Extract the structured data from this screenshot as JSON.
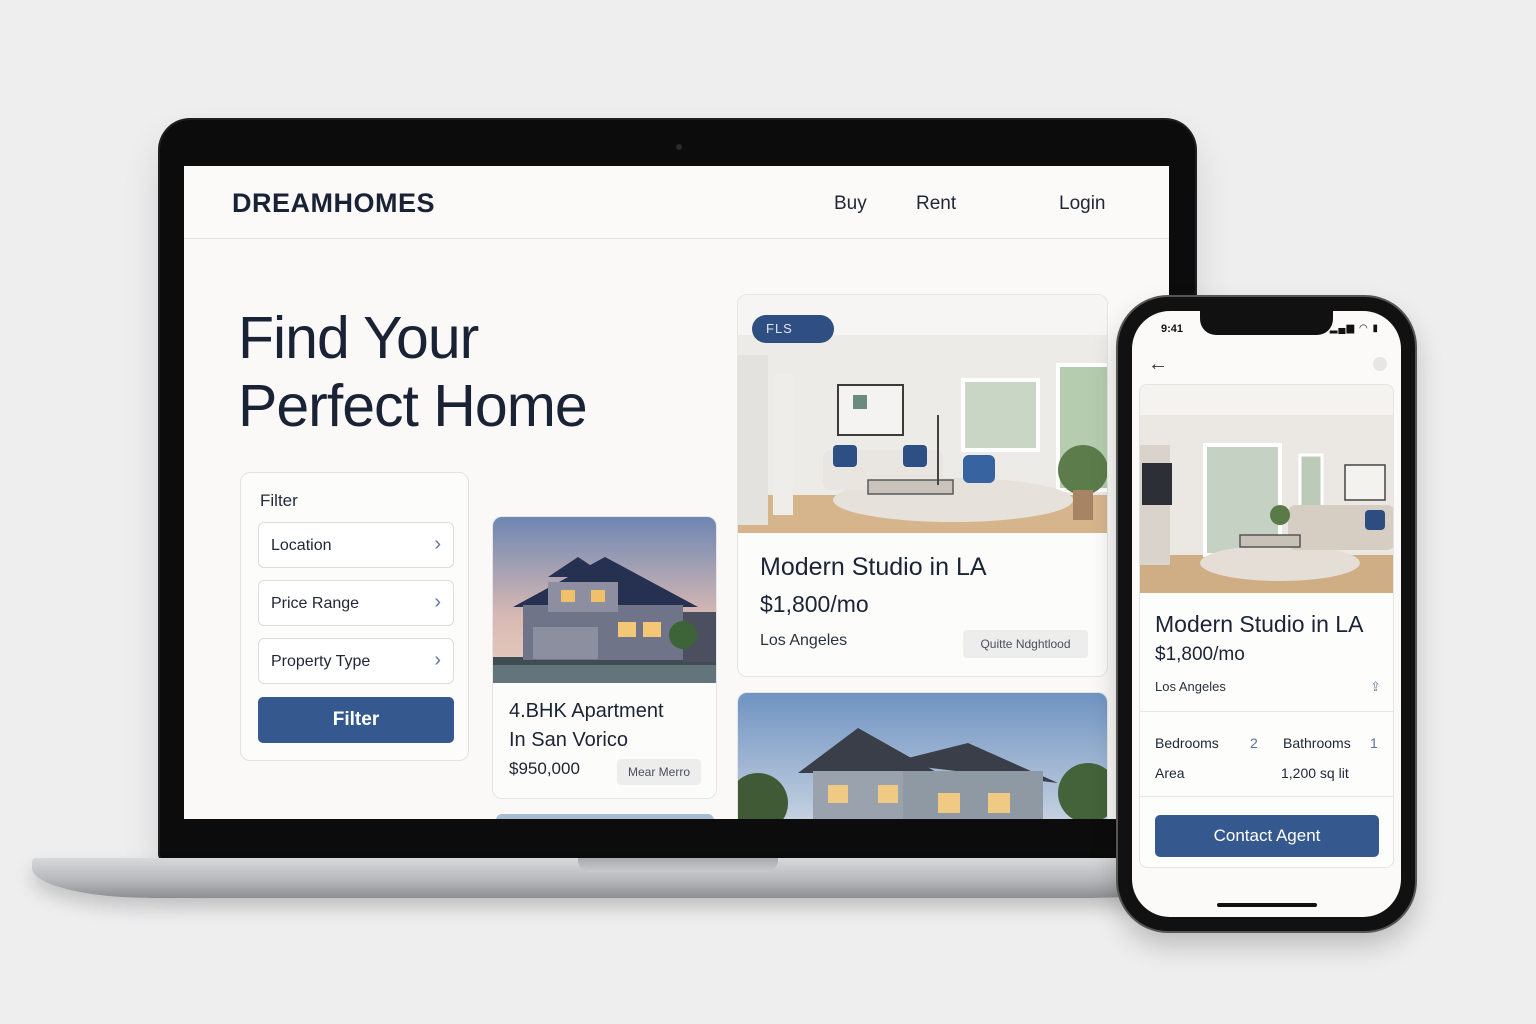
{
  "site": {
    "brand": "DREAMHOMES",
    "nav": {
      "buy": "Buy",
      "rent": "Rent",
      "login": "Login"
    },
    "hero_line1": "Find Your",
    "hero_line2": "Perfect Home",
    "filter": {
      "title": "Filter",
      "fields": [
        "Location",
        "Price Range",
        "Property Type"
      ],
      "button": "Filter"
    },
    "listings": [
      {
        "title_line1": "4.BHK Apartment",
        "title_line2": "In San Vorico",
        "price": "$950,000",
        "tag": "Mear Merro"
      },
      {
        "badge": "FLS",
        "title": "Modern Studio in LA",
        "price": "$1,800/mo",
        "location": "Los Angeles",
        "tag": "Quitte Ndghtlood"
      }
    ]
  },
  "phone": {
    "time": "9:41",
    "status_icons": "signal-wifi-battery",
    "title": "Modern Studio in LA",
    "price": "$1,800/mo",
    "location": "Los Angeles",
    "specs": {
      "bedrooms_label": "Bedrooms",
      "bedrooms": "2",
      "bathrooms_label": "Bathrooms",
      "bathrooms": "1",
      "area_label": "Area",
      "area": "1,200 sq lit"
    },
    "button": "Contact Agent"
  },
  "colors": {
    "accent": "#35598f",
    "badge": "#2f4f82",
    "text": "#1a2336",
    "background": "#eeeeef"
  },
  "icons": [
    "chevron-right-icon",
    "back-arrow-icon",
    "share-icon"
  ]
}
